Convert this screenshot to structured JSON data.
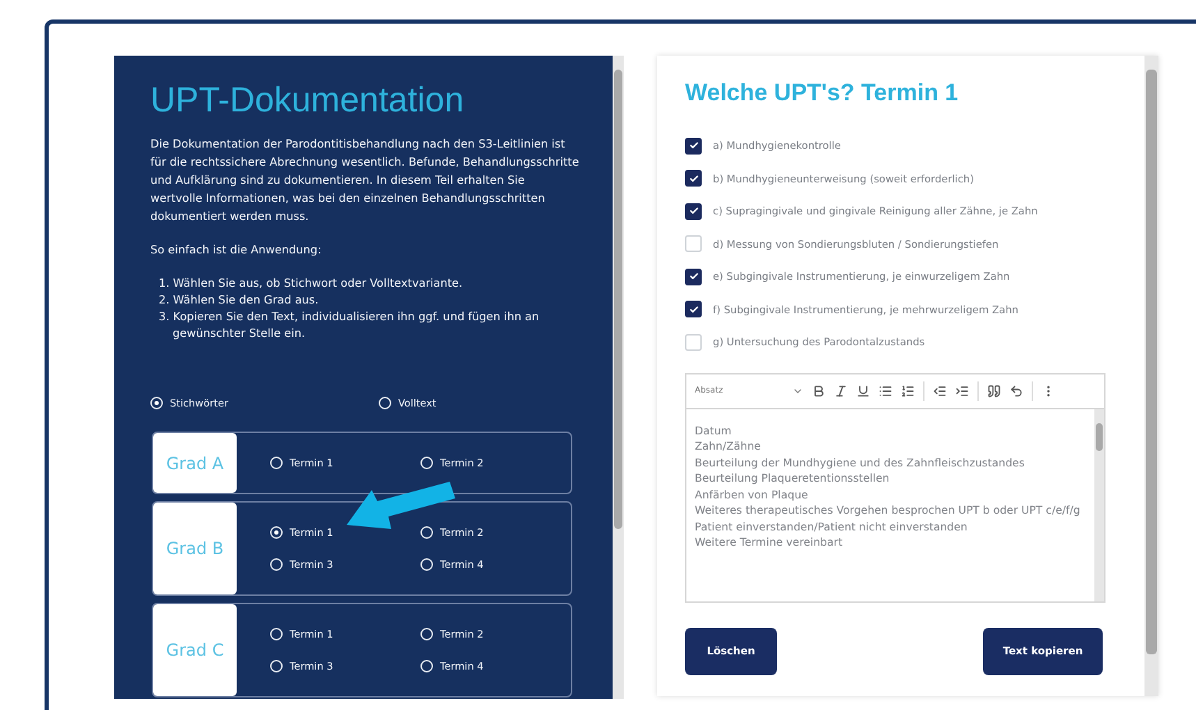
{
  "left_panel": {
    "title": "UPT-Dokumentation",
    "intro": "Die Dokumentation der Parodontitisbehandlung nach den S3-Leitlinien ist für die rechtssichere Abrechnung wesentlich. Befunde, Behandlungsschritte und Aufklärung sind zu dokumentieren. In diesem Teil erhalten Sie wertvolle Informationen, was bei den einzelnen Behandlungsschritten dokumentiert werden muss.",
    "usage_heading": "So einfach ist die Anwendung:",
    "steps": [
      "1. Wählen Sie aus, ob Stichwort oder Volltextvariante.",
      "2. Wählen Sie den Grad aus.",
      "3. Kopieren Sie den Text, individualisieren ihn ggf. und fügen ihn an gewünschter Stelle ein."
    ],
    "modes": [
      {
        "label": "Stichwörter",
        "selected": true
      },
      {
        "label": "Volltext",
        "selected": false
      }
    ],
    "grades": [
      {
        "label": "Grad A",
        "appointments": [
          {
            "label": "Termin 1",
            "selected": false
          },
          {
            "label": "Termin 2",
            "selected": false
          }
        ]
      },
      {
        "label": "Grad B",
        "appointments": [
          {
            "label": "Termin 1",
            "selected": true
          },
          {
            "label": "Termin 2",
            "selected": false
          },
          {
            "label": "Termin 3",
            "selected": false
          },
          {
            "label": "Termin 4",
            "selected": false
          }
        ]
      },
      {
        "label": "Grad C",
        "appointments": [
          {
            "label": "Termin 1",
            "selected": false
          },
          {
            "label": "Termin 2",
            "selected": false
          },
          {
            "label": "Termin 3",
            "selected": false
          },
          {
            "label": "Termin 4",
            "selected": false
          }
        ]
      }
    ]
  },
  "right_panel": {
    "title": "Welche UPT's? Termin 1",
    "items": [
      {
        "label": "a) Mundhygienekontrolle",
        "checked": true
      },
      {
        "label": "b) Mundhygieneunterweisung (soweit erforderlich)",
        "checked": true
      },
      {
        "label": "c) Supragingivale und gingivale Reinigung aller Zähne, je Zahn",
        "checked": true
      },
      {
        "label": "d) Messung von Sondierungsbluten / Sondierungstiefen",
        "checked": false
      },
      {
        "label": "e) Subgingivale Instrumentierung, je einwurzeligem Zahn",
        "checked": true
      },
      {
        "label": "f) Subgingivale Instrumentierung, je mehrwurzeligem Zahn",
        "checked": true
      },
      {
        "label": "g) Untersuchung des Parodontalzustands",
        "checked": false
      }
    ],
    "editor": {
      "format": "Absatz",
      "lines": [
        "Datum",
        "Zahn/Zähne",
        "Beurteilung der Mundhygiene und des Zahnfleischzustandes",
        "Beurteilung Plaqueretentionsstellen",
        "Anfärben von Plaque",
        "Weiteres therapeutisches Vorgehen besprochen UPT b oder UPT c/e/f/g",
        "Patient einverstanden/Patient nicht einverstanden",
        "Weitere Termine vereinbart"
      ]
    },
    "buttons": [
      "Löschen",
      "Text kopieren"
    ]
  }
}
